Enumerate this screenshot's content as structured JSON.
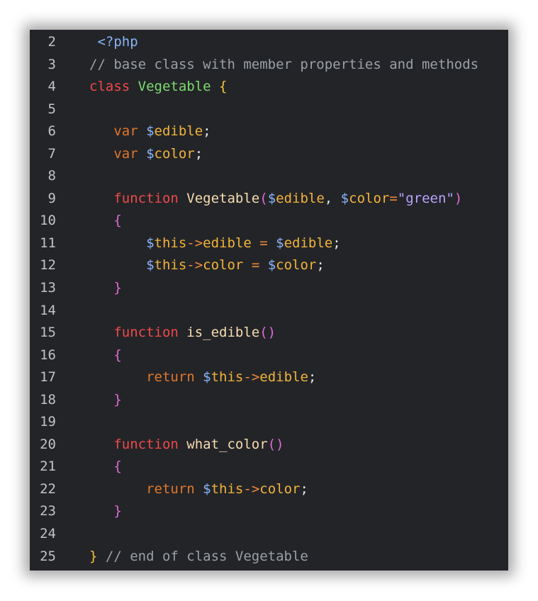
{
  "colors": {
    "background": "#232428",
    "tag": "#8ab4f8",
    "comment": "#9aa0a6",
    "keyword": "#ef4a4a",
    "keyword2": "#e0782b",
    "class_name": "#7ddc6e",
    "brace": "#f6c33c",
    "variable": "#f2b33a",
    "function_name": "#f6dcb0",
    "paren": "#e06ad4",
    "string": "#b9a2ff"
  },
  "lines": [
    {
      "num": "2",
      "tokens": [
        {
          "t": " <?php",
          "c": "tok-tag"
        }
      ]
    },
    {
      "num": "3",
      "tokens": [
        {
          "t": "// base class with member properties and methods",
          "c": "tok-comment"
        }
      ]
    },
    {
      "num": "4",
      "tokens": [
        {
          "t": "class ",
          "c": "tok-kw"
        },
        {
          "t": "Vegetable ",
          "c": "tok-class"
        },
        {
          "t": "{",
          "c": "tok-brace"
        }
      ]
    },
    {
      "num": "5",
      "tokens": []
    },
    {
      "num": "6",
      "tokens": [
        {
          "t": "   var ",
          "c": "tok-kw2"
        },
        {
          "t": "$",
          "c": "tok-var-sign"
        },
        {
          "t": "edible",
          "c": "tok-var"
        },
        {
          "t": ";",
          "c": "tok-plain"
        }
      ]
    },
    {
      "num": "7",
      "tokens": [
        {
          "t": "   var ",
          "c": "tok-kw2"
        },
        {
          "t": "$",
          "c": "tok-var-sign"
        },
        {
          "t": "color",
          "c": "tok-var"
        },
        {
          "t": ";",
          "c": "tok-plain"
        }
      ]
    },
    {
      "num": "8",
      "tokens": []
    },
    {
      "num": "9",
      "tokens": [
        {
          "t": "   function ",
          "c": "tok-kw"
        },
        {
          "t": "Vegetable",
          "c": "tok-fn"
        },
        {
          "t": "(",
          "c": "tok-paren"
        },
        {
          "t": "$",
          "c": "tok-var-sign"
        },
        {
          "t": "edible",
          "c": "tok-var"
        },
        {
          "t": ", ",
          "c": "tok-plain"
        },
        {
          "t": "$",
          "c": "tok-var-sign"
        },
        {
          "t": "color",
          "c": "tok-var"
        },
        {
          "t": "=",
          "c": "tok-op"
        },
        {
          "t": "\"green\"",
          "c": "tok-str"
        },
        {
          "t": ")",
          "c": "tok-paren"
        }
      ]
    },
    {
      "num": "10",
      "tokens": [
        {
          "t": "   {",
          "c": "tok-paren"
        }
      ]
    },
    {
      "num": "11",
      "tokens": [
        {
          "t": "       $",
          "c": "tok-var-sign"
        },
        {
          "t": "this",
          "c": "tok-var"
        },
        {
          "t": "->",
          "c": "tok-op"
        },
        {
          "t": "edible ",
          "c": "tok-var"
        },
        {
          "t": "= ",
          "c": "tok-op"
        },
        {
          "t": "$",
          "c": "tok-var-sign"
        },
        {
          "t": "edible",
          "c": "tok-var"
        },
        {
          "t": ";",
          "c": "tok-plain"
        }
      ]
    },
    {
      "num": "12",
      "tokens": [
        {
          "t": "       $",
          "c": "tok-var-sign"
        },
        {
          "t": "this",
          "c": "tok-var"
        },
        {
          "t": "->",
          "c": "tok-op"
        },
        {
          "t": "color ",
          "c": "tok-var"
        },
        {
          "t": "= ",
          "c": "tok-op"
        },
        {
          "t": "$",
          "c": "tok-var-sign"
        },
        {
          "t": "color",
          "c": "tok-var"
        },
        {
          "t": ";",
          "c": "tok-plain"
        }
      ]
    },
    {
      "num": "13",
      "tokens": [
        {
          "t": "   }",
          "c": "tok-paren"
        }
      ]
    },
    {
      "num": "14",
      "tokens": []
    },
    {
      "num": "15",
      "tokens": [
        {
          "t": "   function ",
          "c": "tok-kw"
        },
        {
          "t": "is_edible",
          "c": "tok-fn"
        },
        {
          "t": "()",
          "c": "tok-paren"
        }
      ]
    },
    {
      "num": "16",
      "tokens": [
        {
          "t": "   {",
          "c": "tok-paren"
        }
      ]
    },
    {
      "num": "17",
      "tokens": [
        {
          "t": "       return ",
          "c": "tok-kw2"
        },
        {
          "t": "$",
          "c": "tok-var-sign"
        },
        {
          "t": "this",
          "c": "tok-var"
        },
        {
          "t": "->",
          "c": "tok-op"
        },
        {
          "t": "edible",
          "c": "tok-var"
        },
        {
          "t": ";",
          "c": "tok-plain"
        }
      ]
    },
    {
      "num": "18",
      "tokens": [
        {
          "t": "   }",
          "c": "tok-paren"
        }
      ]
    },
    {
      "num": "19",
      "tokens": []
    },
    {
      "num": "20",
      "tokens": [
        {
          "t": "   function ",
          "c": "tok-kw"
        },
        {
          "t": "what_color",
          "c": "tok-fn"
        },
        {
          "t": "()",
          "c": "tok-paren"
        }
      ]
    },
    {
      "num": "21",
      "tokens": [
        {
          "t": "   {",
          "c": "tok-paren"
        }
      ]
    },
    {
      "num": "22",
      "tokens": [
        {
          "t": "       return ",
          "c": "tok-kw2"
        },
        {
          "t": "$",
          "c": "tok-var-sign"
        },
        {
          "t": "this",
          "c": "tok-var"
        },
        {
          "t": "->",
          "c": "tok-op"
        },
        {
          "t": "color",
          "c": "tok-var"
        },
        {
          "t": ";",
          "c": "tok-plain"
        }
      ]
    },
    {
      "num": "23",
      "tokens": [
        {
          "t": "   }",
          "c": "tok-paren"
        }
      ]
    },
    {
      "num": "24",
      "tokens": []
    },
    {
      "num": "25",
      "tokens": [
        {
          "t": "} ",
          "c": "tok-brace"
        },
        {
          "t": "// end of class Vegetable",
          "c": "tok-comment"
        }
      ]
    }
  ]
}
